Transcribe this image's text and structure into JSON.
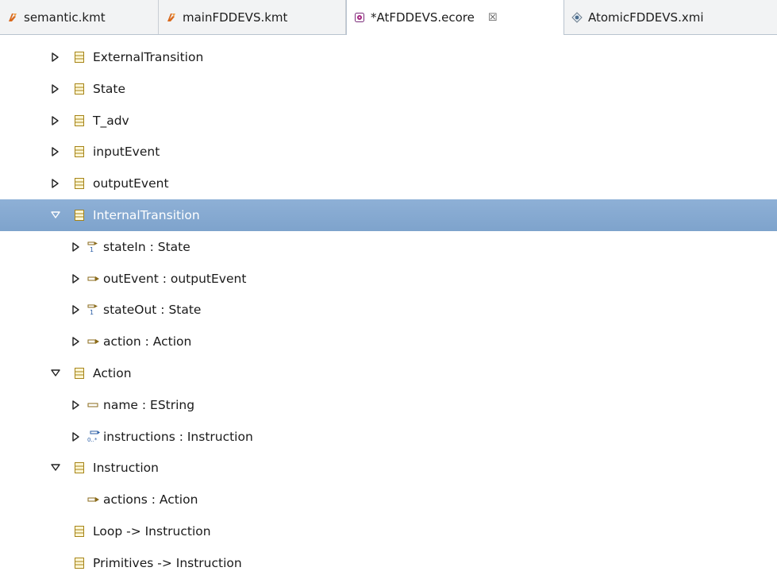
{
  "tabs": [
    {
      "label": "semantic.kmt",
      "icon": "kmt-file-icon",
      "active": false
    },
    {
      "label": "mainFDDEVS.kmt",
      "icon": "kmt-file-icon",
      "active": false
    },
    {
      "label": "*AtFDDEVS.ecore",
      "icon": "ecore-file-icon",
      "active": true,
      "close": "☒"
    },
    {
      "label": "AtomicFDDEVS.xmi",
      "icon": "xmi-file-icon",
      "active": false
    }
  ],
  "tree": [
    {
      "label": "ExternalTransition",
      "icon": "eclass-icon",
      "toggle": "collapsed",
      "level": 0
    },
    {
      "label": "State",
      "icon": "eclass-icon",
      "toggle": "collapsed",
      "level": 0
    },
    {
      "label": "T_adv",
      "icon": "eclass-icon",
      "toggle": "collapsed",
      "level": 0
    },
    {
      "label": "inputEvent",
      "icon": "eclass-icon",
      "toggle": "collapsed",
      "level": 0
    },
    {
      "label": "outputEvent",
      "icon": "eclass-icon",
      "toggle": "collapsed",
      "level": 0
    },
    {
      "label": "InternalTransition",
      "icon": "eclass-icon",
      "toggle": "expanded",
      "level": 0,
      "selected": true
    },
    {
      "label": "stateIn : State",
      "icon": "ereference-single-icon",
      "toggle": "collapsed",
      "level": 1
    },
    {
      "label": "outEvent : outputEvent",
      "icon": "ereference-icon",
      "toggle": "collapsed",
      "level": 1
    },
    {
      "label": "stateOut : State",
      "icon": "ereference-single-icon",
      "toggle": "collapsed",
      "level": 1
    },
    {
      "label": "action : Action",
      "icon": "ereference-icon",
      "toggle": "collapsed",
      "level": 1
    },
    {
      "label": "Action",
      "icon": "eclass-icon",
      "toggle": "expanded",
      "level": 0
    },
    {
      "label": "name : EString",
      "icon": "eattribute-icon",
      "toggle": "collapsed",
      "level": 1
    },
    {
      "label": "instructions : Instruction",
      "icon": "ereference-many-icon",
      "toggle": "collapsed",
      "level": 1
    },
    {
      "label": "Instruction",
      "icon": "eclass-icon",
      "toggle": "expanded",
      "level": 0
    },
    {
      "label": "actions : Action",
      "icon": "ereference-icon",
      "toggle": "none",
      "level": 1
    },
    {
      "label": "Loop -> Instruction",
      "icon": "eclass-icon",
      "toggle": "none",
      "level": 0
    },
    {
      "label": "Primitives -> Instruction",
      "icon": "eclass-icon",
      "toggle": "none",
      "level": 0
    }
  ],
  "colors": {
    "selection": "#7ea3cc",
    "eclass": "#c9a227",
    "reference": "#8a6a1a"
  }
}
